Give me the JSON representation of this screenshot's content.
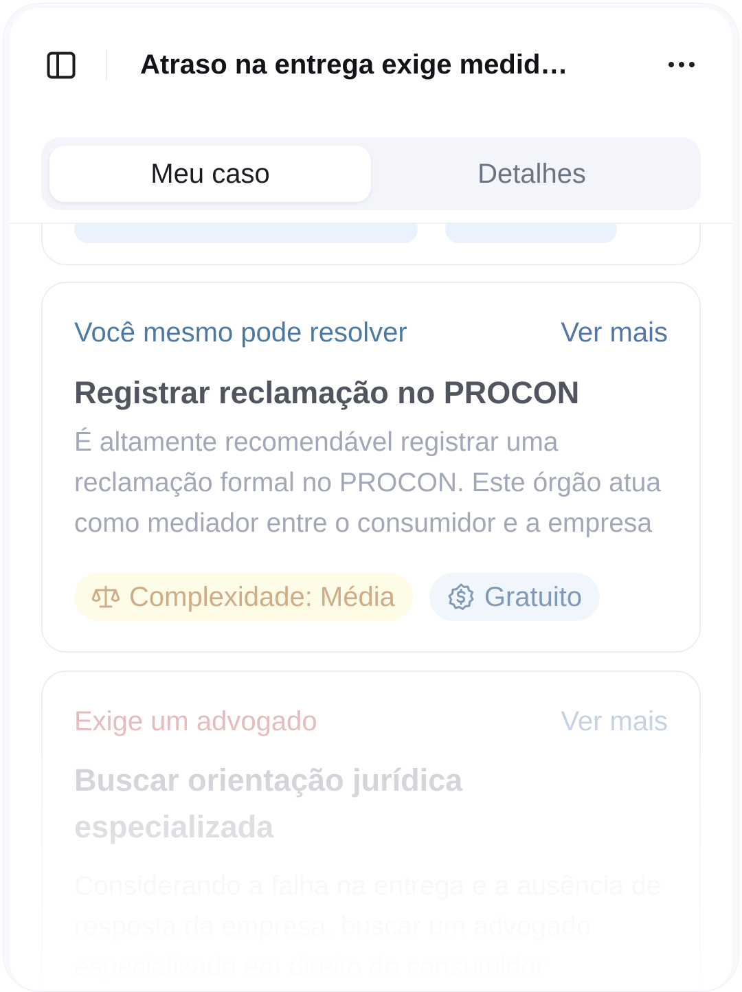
{
  "header": {
    "title": "Atraso na entrega exige medid…",
    "sidebar_icon": "sidebar-toggle-icon",
    "more_icon": "more-horizontal-icon"
  },
  "tabs": [
    {
      "label": "Meu caso",
      "active": true
    },
    {
      "label": "Detalhes",
      "active": false
    }
  ],
  "cards": [
    {
      "label": "Você mesmo pode resolver",
      "link": "Ver mais",
      "title": "Registrar reclamação no PROCON",
      "description": "É altamente recomendável registrar uma reclamação formal no PROCON. Este órgão atua como mediador entre o consumidor e a empresa",
      "badges": [
        {
          "icon": "scale-icon",
          "text": "Complexidade: Média",
          "color": "#cfac88"
        },
        {
          "icon": "dollar-badge-icon",
          "text": "Gratuito",
          "color": "#7f99b7"
        }
      ]
    },
    {
      "label": "Exige um advogado",
      "link": "Ver mais",
      "title": "Buscar orientação jurídica especializada",
      "description": "Considerando a falha na entrega e a ausência de resposta da empresa, buscar um advogado especializado em direito do consumidor"
    }
  ],
  "colors": {
    "accent_blue": "#4c7aa3",
    "warning_label": "#e2b6b6",
    "tab_bg": "#f3f5fb"
  }
}
